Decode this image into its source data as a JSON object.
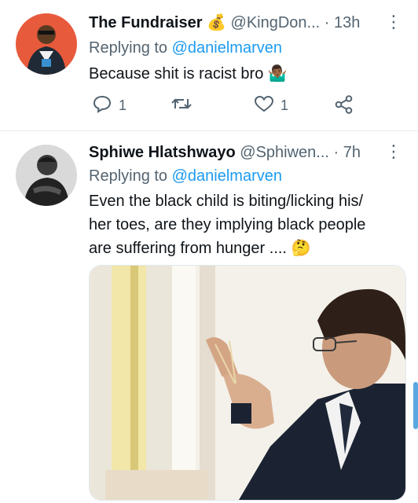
{
  "tweets": [
    {
      "name": "The Fundraiser",
      "name_emoji": "💰",
      "handle": "@KingDon...",
      "time": "· 13h",
      "reply_prefix": "Replying to",
      "reply_to": "@danielmarven",
      "text": "Because shit is racist bro",
      "text_emoji": "🤷🏾‍♂️",
      "reply_count": "1",
      "retweet_count": "",
      "like_count": "1",
      "icons": [
        "reply-icon",
        "retweet-icon",
        "like-icon",
        "share-icon"
      ]
    },
    {
      "name": "Sphiwe Hlatshwayo",
      "handle": "@Sphiwen...",
      "time": "· 7h",
      "reply_prefix": "Replying to",
      "reply_to": "@danielmarven",
      "text_lines": [
        "Even the black child is biting/licking his/",
        "her toes, are they implying black people",
        "are suffering from hunger ...."
      ],
      "text_emoji": "🤔"
    }
  ],
  "colors": {
    "accent": "#1d9bf0",
    "secondary_text": "#536471",
    "divider": "#e6ecf0"
  }
}
